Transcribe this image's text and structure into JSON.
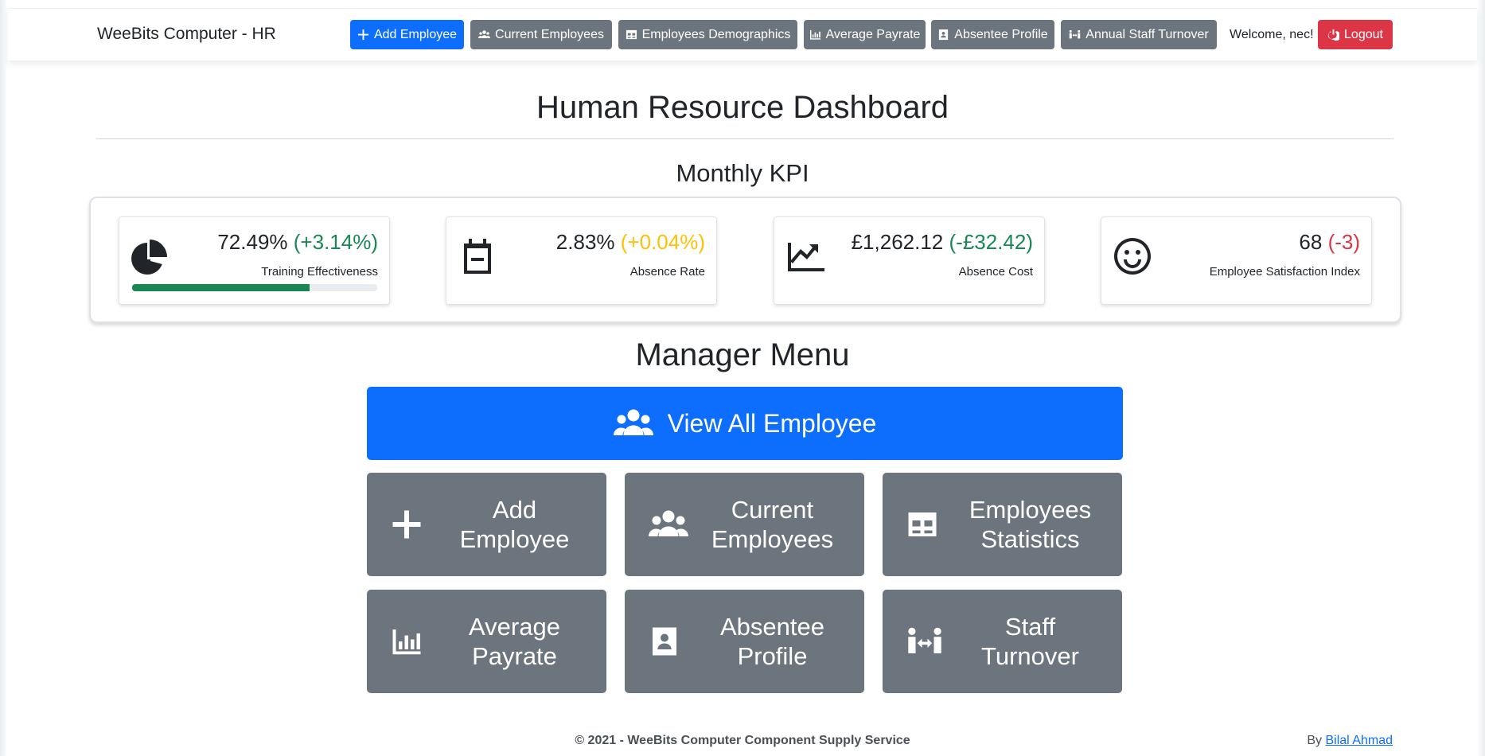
{
  "navbar": {
    "brand": "WeeBits Computer - HR",
    "buttons": [
      {
        "label": "Add Employee",
        "icon": "plus-icon"
      },
      {
        "label": "Current Employees",
        "icon": "users-icon"
      },
      {
        "label": "Employees Demographics",
        "icon": "table-icon"
      },
      {
        "label": "Average Payrate",
        "icon": "bar-chart-icon"
      },
      {
        "label": "Absentee Profile",
        "icon": "address-book-icon"
      },
      {
        "label": "Annual Staff Turnover",
        "icon": "people-arrows-icon"
      }
    ],
    "welcome": "Welcome, nec!",
    "logout": "Logout"
  },
  "page_title": "Human Resource Dashboard",
  "kpi": {
    "title": "Monthly KPI",
    "cards": [
      {
        "value": "72.49%",
        "delta": "(+3.14%)",
        "label": "Training Effectiveness",
        "icon": "pie-chart-icon",
        "progress": 0.7249
      },
      {
        "value": "2.83%",
        "delta": "(+0.04%)",
        "label": "Absence Rate",
        "icon": "calendar-minus-icon"
      },
      {
        "value": "£1,262.12",
        "delta": "(-£32.42)",
        "label": "Absence Cost",
        "icon": "line-chart-icon"
      },
      {
        "value": "68",
        "delta": "(-3)",
        "label": "Employee Satisfaction Index",
        "icon": "smile-icon"
      }
    ]
  },
  "menu": {
    "title": "Manager Menu",
    "view_all": "View All Employee",
    "tiles": [
      {
        "line1": "Add",
        "line2": "Employee",
        "icon": "plus-icon"
      },
      {
        "line1": "Current",
        "line2": "Employees",
        "icon": "users-icon"
      },
      {
        "line1": "Employees",
        "line2": "Statistics",
        "icon": "table-icon"
      },
      {
        "line1": "Average",
        "line2": "Payrate",
        "icon": "bar-chart-icon"
      },
      {
        "line1": "Absentee",
        "line2": "Profile",
        "icon": "address-book-icon"
      },
      {
        "line1": "Staff",
        "line2": "Turnover",
        "icon": "people-arrows-icon"
      }
    ]
  },
  "footer": {
    "copyright": "© 2021 - WeeBits Computer Component Supply Service",
    "by": "By",
    "author": "Bilal Ahmad"
  },
  "colors": {
    "primary": "#0d6efd",
    "secondary": "#6c757d",
    "danger": "#dc3545",
    "success": "#198754",
    "warning": "#ffc107"
  }
}
